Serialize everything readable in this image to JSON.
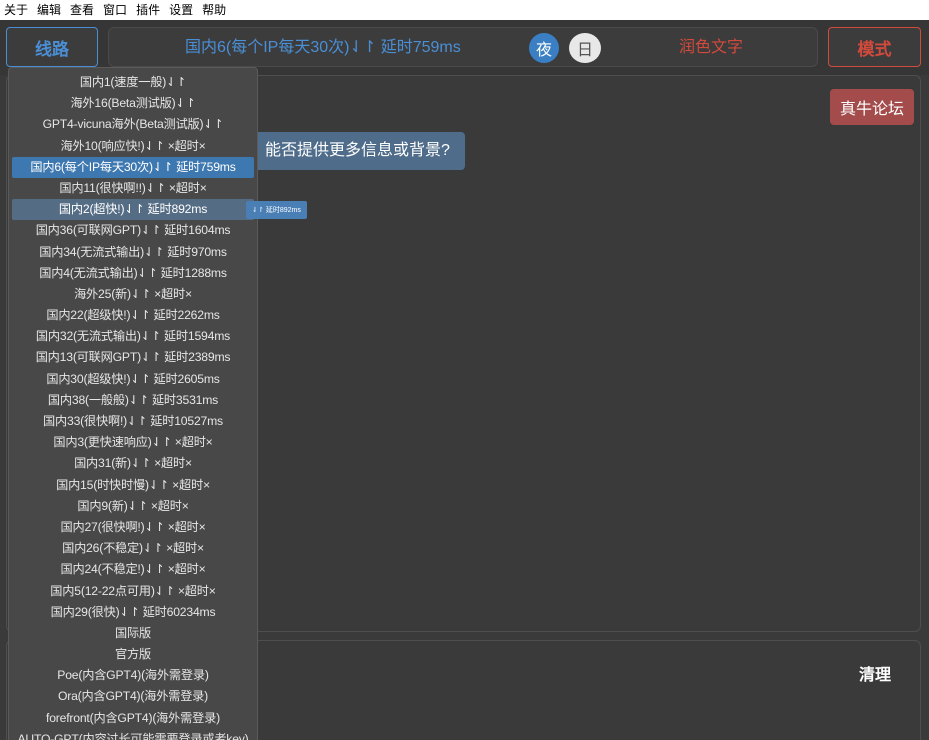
{
  "menubar": {
    "items": [
      "关于",
      "编辑",
      "查看",
      "窗口",
      "插件",
      "设置",
      "帮助"
    ]
  },
  "header": {
    "route_button": "线路",
    "status_text": "国内6(每个IP每天30次)⇃↾ 延时759ms",
    "night_label": "夜",
    "day_label": "日",
    "polish_label": "润色文字",
    "mode_button": "模式"
  },
  "chat": {
    "forum_button": "真牛论坛",
    "bubble_text": "能否提供更多信息或背景?"
  },
  "input": {
    "clear_button": "清理"
  },
  "tooltip": {
    "text": "⇃↾ 延时892ms"
  },
  "dropdown": {
    "selected_index": 4,
    "hovered_index": 6,
    "items": [
      "国内1(速度一般)⇃↾",
      "海外16(Beta测试版)⇃↾",
      "GPT4-vicuna海外(Beta测试版)⇃↾",
      "海外10(响应快!)⇃↾ ×超时×",
      "国内6(每个IP每天30次)⇃↾ 延时759ms",
      "国内11(很快啊!!)⇃↾ ×超时×",
      "国内2(超快!)⇃↾ 延时892ms",
      "国内36(可联网GPT)⇃↾ 延时1604ms",
      "国内34(无流式输出)⇃↾ 延时970ms",
      "国内4(无流式输出)⇃↾ 延时1288ms",
      "海外25(新)⇃↾ ×超时×",
      "国内22(超级快!)⇃↾ 延时2262ms",
      "国内32(无流式输出)⇃↾ 延时1594ms",
      "国内13(可联网GPT)⇃↾ 延时2389ms",
      "国内30(超级快!)⇃↾ 延时2605ms",
      "国内38(一般般)⇃↾ 延时3531ms",
      "国内33(很快啊!)⇃↾ 延时10527ms",
      "国内3(更快速响应)⇃↾ ×超时×",
      "国内31(新)⇃↾ ×超时×",
      "国内15(时快时慢)⇃↾ ×超时×",
      "国内9(新)⇃↾ ×超时×",
      "国内27(很快啊!)⇃↾ ×超时×",
      "国内26(不稳定)⇃↾ ×超时×",
      "国内24(不稳定!)⇃↾ ×超时×",
      "国内5(12-22点可用)⇃↾ ×超时×",
      "国内29(很快)⇃↾ 延时60234ms",
      "国际版",
      "官方版",
      "Poe(内含GPT4)(海外需登录)",
      "Ora(内含GPT4)(海外需登录)",
      "forefront(内含GPT4)(海外需登录)",
      "AUTO-GPT(内容过长可能需要登录或者key)"
    ]
  },
  "colors": {
    "accent_blue": "#4a8fd6",
    "accent_red": "#d24a3c",
    "selected_bg": "#3e78b0",
    "background": "#3a3a3a"
  }
}
